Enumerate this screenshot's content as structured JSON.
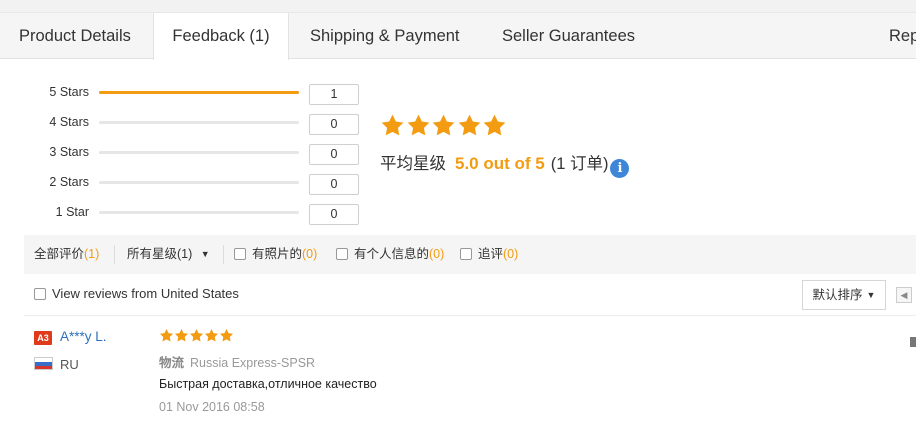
{
  "tabs": [
    {
      "label": "Product Details"
    },
    {
      "label": "Feedback (1)"
    },
    {
      "label": "Shipping & Payment"
    },
    {
      "label": "Seller Guarantees"
    },
    {
      "label": "Repo"
    }
  ],
  "ratings": {
    "rows": [
      {
        "label": "5 Stars",
        "count": "1",
        "fraction": 1.0
      },
      {
        "label": "4 Stars",
        "count": "0",
        "fraction": 0
      },
      {
        "label": "3 Stars",
        "count": "0",
        "fraction": 0
      },
      {
        "label": "2 Stars",
        "count": "0",
        "fraction": 0
      },
      {
        "label": "1 Star",
        "count": "0",
        "fraction": 0
      }
    ],
    "average_stars": 5,
    "average_label": "平均星级",
    "average_value": "5.0 out of 5",
    "order_count": "(1 订单)",
    "info_glyph": "i",
    "star_color": "#f39c12"
  },
  "filters": {
    "all": {
      "label": "全部评价",
      "count": "(1)"
    },
    "stars_dropdown": {
      "label": "所有星级",
      "count": "(1)"
    },
    "with_photos": {
      "label": "有照片的",
      "count": "(0)"
    },
    "with_info": {
      "label": "有个人信息的",
      "count": "(0)"
    },
    "additional": {
      "label": "追评",
      "count": "(0)"
    }
  },
  "view_us_label": "View reviews from United States",
  "sort": {
    "label": "默认排序"
  },
  "review": {
    "badge": "A3",
    "name": "A***y L.",
    "country": "RU",
    "stars": 5,
    "logistics_label": "物流",
    "logistics_value": "Russia Express-SPSR",
    "text": "Быстрая доставка,отличное качество",
    "date": "01 Nov 2016 08:58"
  }
}
